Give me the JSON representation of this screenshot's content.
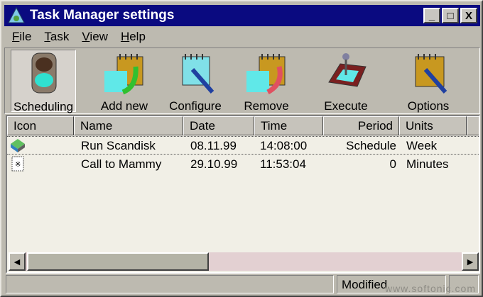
{
  "window": {
    "title": "Task Manager settings",
    "minimize": "_",
    "maximize": "□",
    "close": "X"
  },
  "menu": [
    {
      "label": "File",
      "u": "F",
      "rest": "ile"
    },
    {
      "label": "Task",
      "u": "T",
      "rest": "ask"
    },
    {
      "label": "View",
      "u": "V",
      "rest": "iew"
    },
    {
      "label": "Help",
      "u": "H",
      "rest": "elp"
    }
  ],
  "toolbar": {
    "scheduling": "Scheduling",
    "add_new": "Add new",
    "configure": "Configure",
    "remove": "Remove",
    "execute": "Execute",
    "options": "Options"
  },
  "columns": [
    "Icon",
    "Name",
    "Date",
    "Time",
    "Period",
    "Units"
  ],
  "rows": [
    {
      "name": "Run Scandisk",
      "date": "08.11.99",
      "time": "14:08:00",
      "period": "Schedule",
      "units": "Week"
    },
    {
      "name": "Call to Mammy",
      "date": "29.10.99",
      "time": "11:53:04",
      "period": "0",
      "units": "Minutes"
    }
  ],
  "status": {
    "modified": "Modified"
  },
  "watermark": "www.softonic.com"
}
